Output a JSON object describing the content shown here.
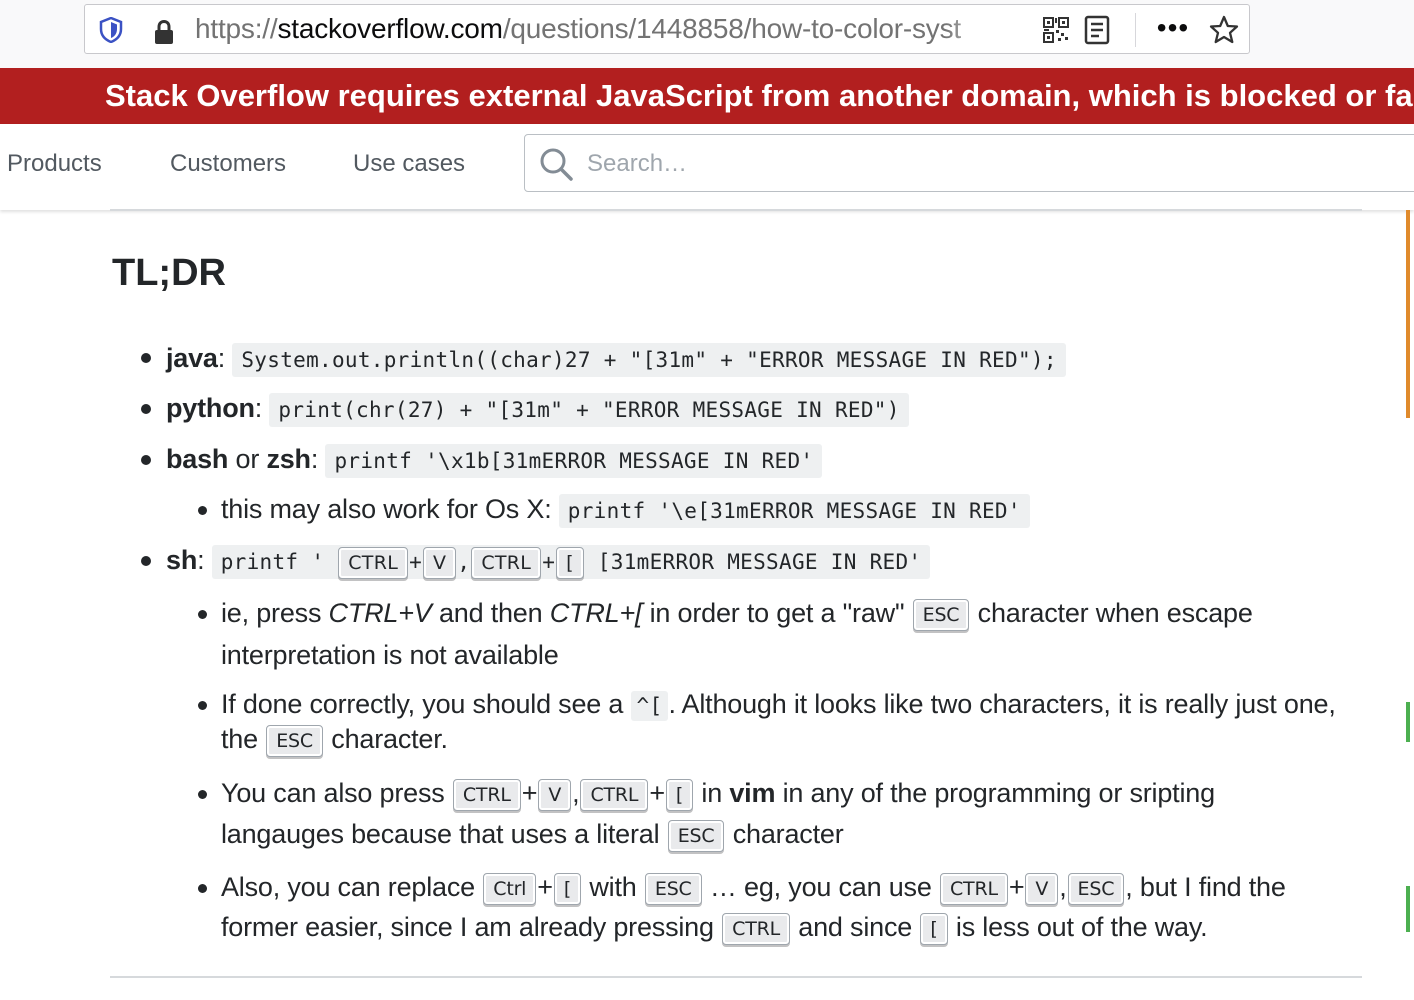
{
  "browser": {
    "url_prefix": "https://",
    "url_host": "stackoverflow.com",
    "url_path": "/questions/1448858/how-to-color-syst"
  },
  "banner": {
    "text": "Stack Overflow requires external JavaScript from another domain, which is blocked or failed to load."
  },
  "nav": {
    "products": "Products",
    "customers": "Customers",
    "use_cases": "Use cases",
    "search_placeholder": "Search…"
  },
  "content": {
    "heading": "TL;DR",
    "java_label": "java",
    "java_code": "System.out.println((char)27 + \"[31m\" + \"ERROR MESSAGE IN RED\");",
    "python_label": "python",
    "python_code": "print(chr(27) + \"[31m\" + \"ERROR MESSAGE IN RED\")",
    "bash_label": "bash",
    "or_text": " or ",
    "zsh_label": "zsh",
    "bash_code": "printf '\\x1b[31mERROR MESSAGE IN RED'",
    "osx_text": "this may also work for Os X: ",
    "osx_code": "printf '\\e[31mERROR MESSAGE IN RED'",
    "sh_label": "sh",
    "sh_code_start": "printf ' ",
    "sh_code_end": " [31mERROR MESSAGE IN RED'",
    "keys": {
      "ctrl": "CTRL",
      "v": "V",
      "bracket": "[",
      "esc": "ESC",
      "ctrl_lower": "Ctrl"
    },
    "p1_a": "ie, press ",
    "p1_ctrlv": "CTRL+V",
    "p1_b": " and then ",
    "p1_ctrlb": "CTRL+[",
    "p1_c": " in order to get a \"raw\" ",
    "p1_d": " character when escape",
    "p1_line2": "interpretation is not available",
    "p2_a": "If done correctly, you should see a ",
    "p2_code": "^[",
    "p2_b": ". Although it looks like two characters, it is really just one,",
    "p2_c": "the ",
    "p2_d": " character.",
    "p3_a": "You can also press ",
    "p3_b": " in ",
    "p3_vim": "vim",
    "p3_c": " in any of the programming or sripting",
    "p3_line2": "langauges because that uses a literal ",
    "p3_d": " character",
    "p4_a": "Also, you can replace ",
    "p4_b": " with ",
    "p4_c": " … eg, you can use ",
    "p4_d": ", but I find the",
    "p4_line2": "former easier, since I am already pressing ",
    "p4_e": " and since ",
    "p4_f": " is less out of the way."
  }
}
